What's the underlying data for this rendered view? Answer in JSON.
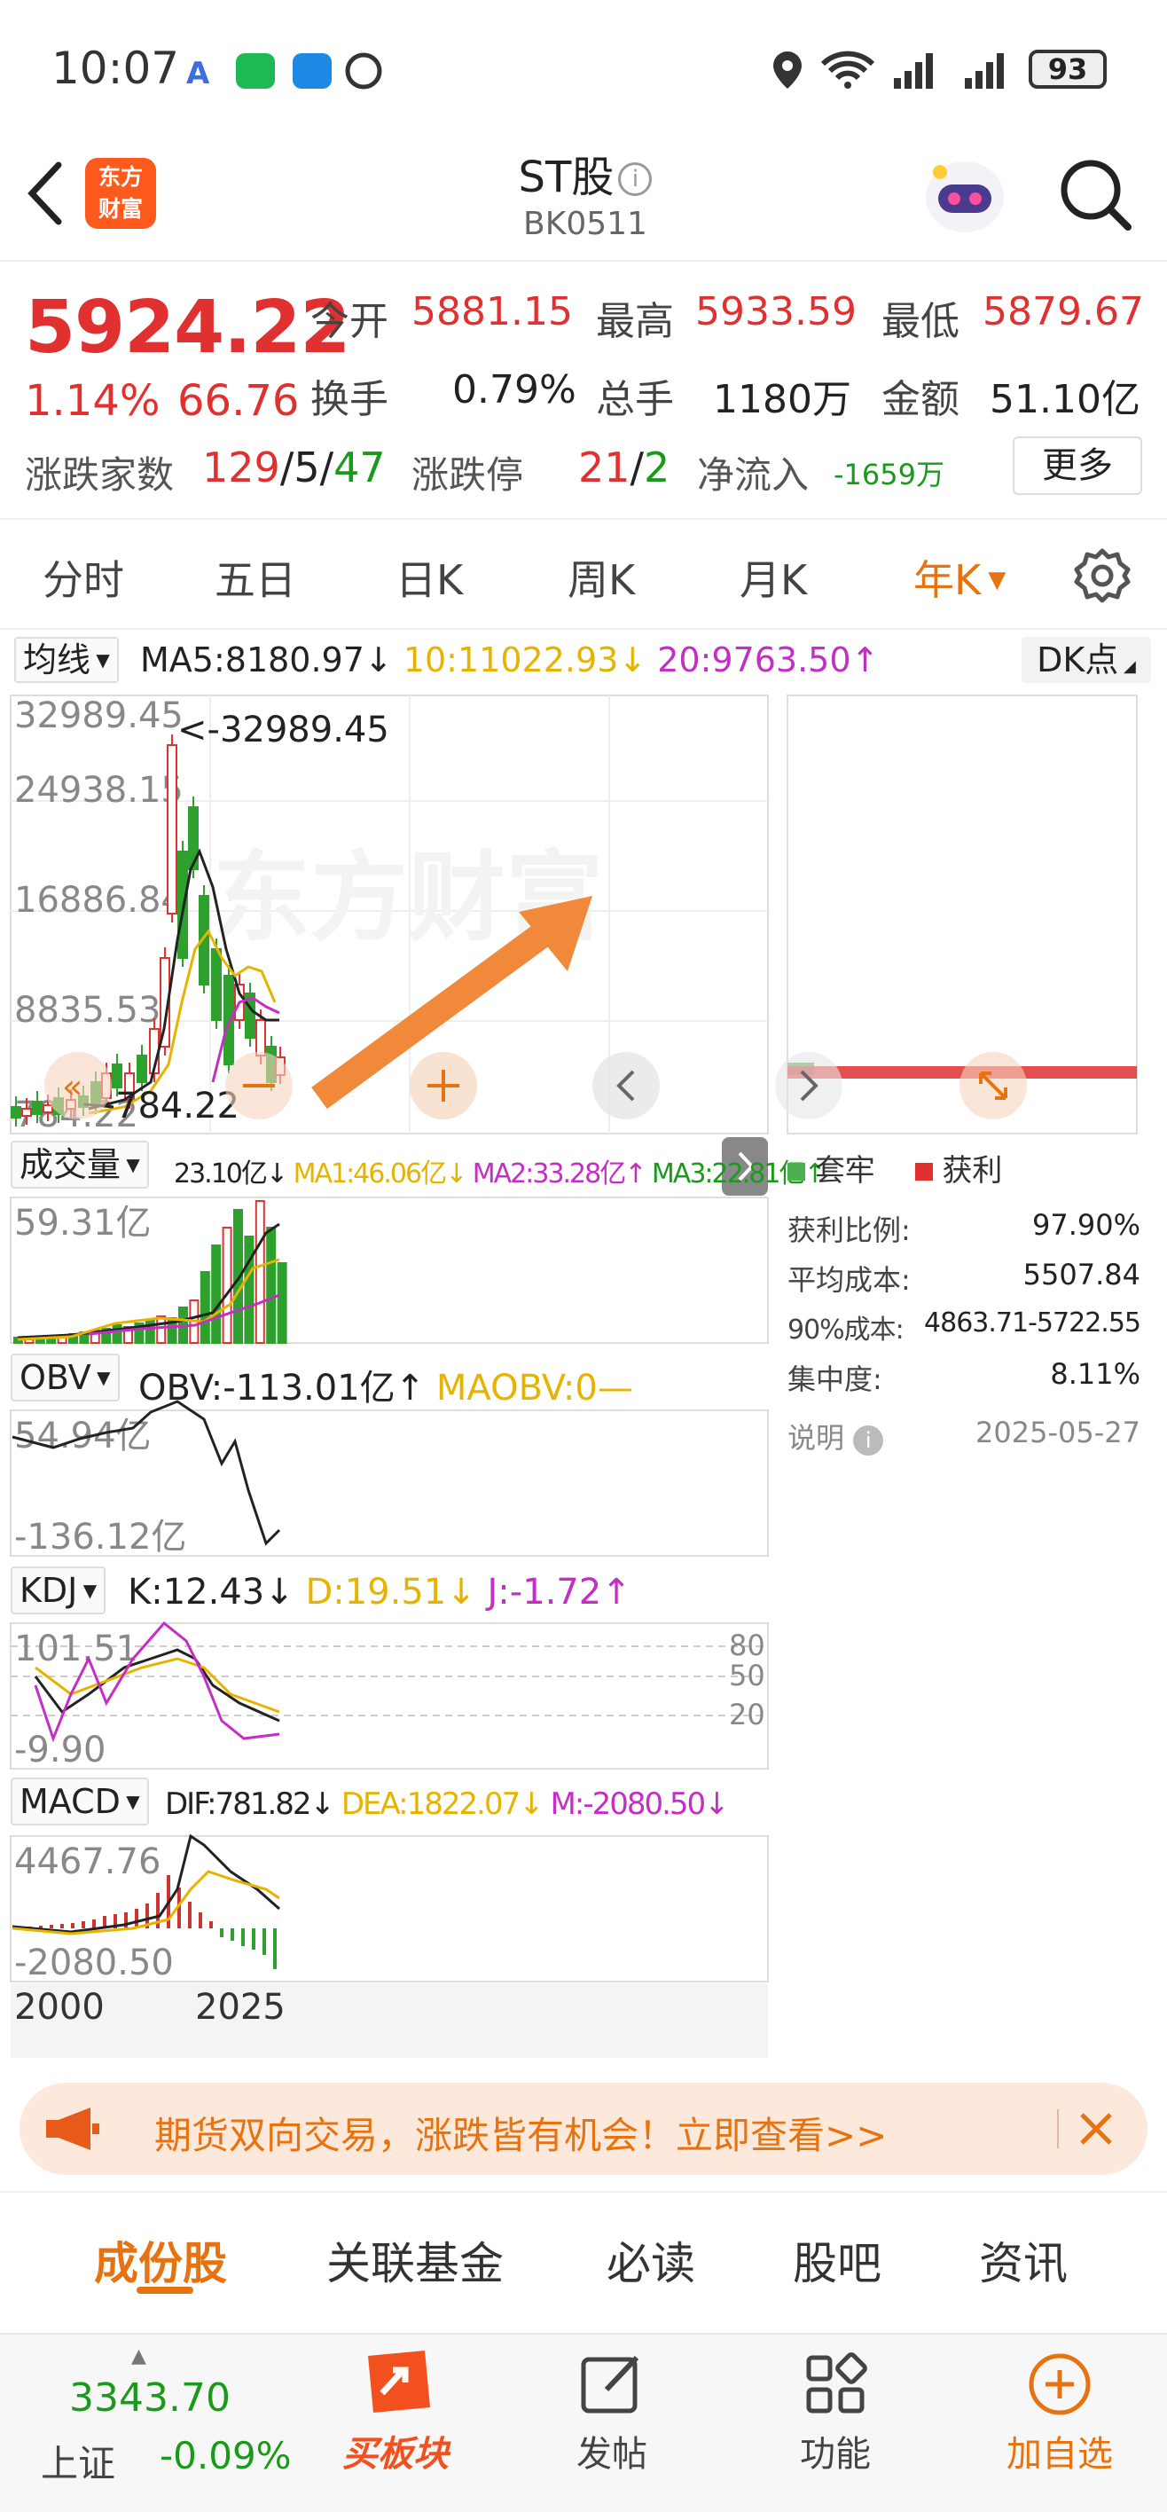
{
  "status_bar": {
    "time": "10:07",
    "battery": "93"
  },
  "header": {
    "app_logo": "东方\n财富",
    "title": "ST股",
    "code": "BK0511"
  },
  "quote": {
    "price": "5924.22",
    "change_pct": "1.14%",
    "change": "66.76",
    "open_label": "今开",
    "open": "5881.15",
    "high_label": "最高",
    "high": "5933.59",
    "low_label": "最低",
    "low": "5879.67",
    "turnover_label": "换手",
    "turnover": "0.79%",
    "volume_label": "总手",
    "volume": "1180万",
    "amount_label": "金额",
    "amount": "51.10亿",
    "breadth_label": "涨跌家数",
    "breadth_up": "129",
    "breadth_flat": "5",
    "breadth_down": "47",
    "limit_label": "涨跌停",
    "limit_up": "21",
    "limit_down": "2",
    "netflow_label": "净流入",
    "netflow": "-1659万",
    "more": "更多"
  },
  "period_tabs": [
    "分时",
    "五日",
    "日K",
    "周K",
    "月K",
    "年K"
  ],
  "ma": {
    "selector": "均线",
    "ma5": "MA5:8180.97",
    "ma10": "10:11022.93",
    "ma20": "20:9763.50",
    "dk": "DK点"
  },
  "kchart": {
    "ticks": [
      "32989.45",
      "24938.15",
      "16886.84",
      "8835.53",
      "784.22"
    ],
    "high_ann": "<-32989.45",
    "low_ann": "784.22",
    "watermark": "东方财富"
  },
  "volume": {
    "selector": "成交量",
    "v": "23.10亿",
    "ma1": "MA1:46.06亿",
    "ma2": "MA2:33.28亿",
    "ma3": "MA3:22.81亿",
    "top": "59.31亿"
  },
  "obv": {
    "selector": "OBV",
    "v": "OBV:-113.01亿",
    "ma": "MAOBV:0",
    "top": "54.94亿",
    "bottom": "-136.12亿"
  },
  "kdj": {
    "selector": "KDJ",
    "k": "K:12.43",
    "d": "D:19.51",
    "j": "J:-1.72",
    "top": "101.51",
    "bottom": "-9.90",
    "levels": [
      "80",
      "50",
      "20"
    ]
  },
  "macd": {
    "selector": "MACD",
    "dif": "DIF:781.82",
    "dea": "DEA:1822.07",
    "m": "M:-2080.50",
    "top": "4467.76",
    "bottom": "-2080.50"
  },
  "xaxis": {
    "start": "2000",
    "end": "2025"
  },
  "chips": {
    "legend_trapped": "套牢",
    "legend_profit": "获利",
    "rows": [
      {
        "label": "获利比例:",
        "value": "97.90%"
      },
      {
        "label": "平均成本:",
        "value": "5507.84"
      },
      {
        "label": "90%成本:",
        "value": "4863.71-5722.55"
      },
      {
        "label": "集中度:",
        "value": "8.11%"
      }
    ],
    "note": "说明",
    "date": "2025-05-27"
  },
  "banner": {
    "text": "期货双向交易，涨跌皆有机会！立即查看>>"
  },
  "content_tabs": [
    "成份股",
    "关联基金",
    "必读",
    "股吧",
    "资讯"
  ],
  "bottom_nav": {
    "index_value": "3343.70",
    "index_name": "上证",
    "index_change": "-0.09%",
    "buy": "买板块",
    "post": "发帖",
    "func": "功能",
    "add": "加自选"
  },
  "colors": {
    "accent": "#e6730f",
    "up": "#e03030",
    "down": "#1a9a1a"
  }
}
